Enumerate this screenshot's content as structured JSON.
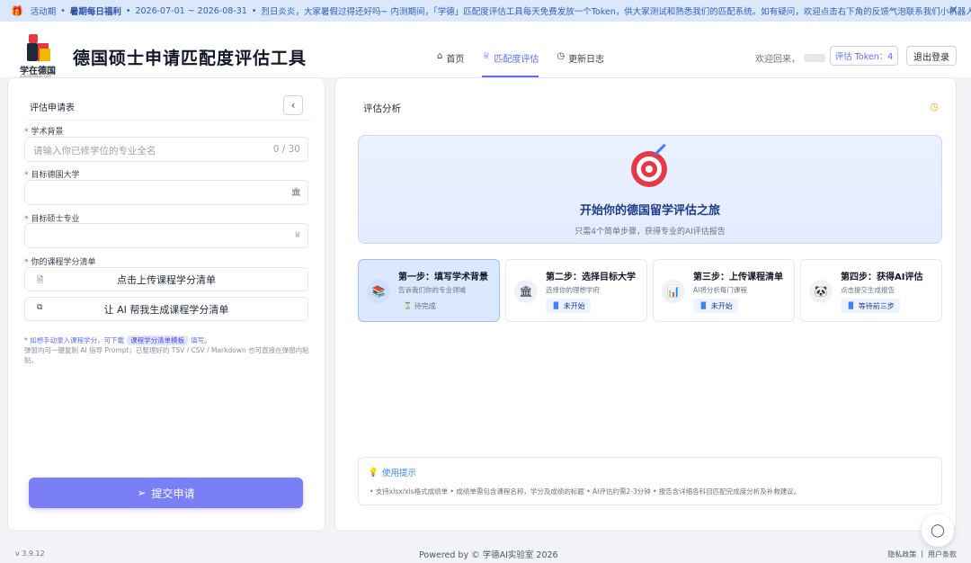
{
  "banner": {
    "gift_icon": "gift-icon",
    "label": "活动期",
    "campaign": "暑期每日福利",
    "dates": "2026-07-01 ~ 2026-08-31",
    "message": "烈日炎炎，大家暑假过得还好吗~ 内测期间，「学德」匹配度评估工具每天免费发放一个Token，供大家测试和熟悉我们的匹配系统。如有疑问，欢迎点击右下角的反馈气泡联系我们小机器人儿喔~",
    "close": "×"
  },
  "header": {
    "logo_text": "学在德国",
    "logo_sub": "xuezaideguo.com",
    "title": "德国硕士申请匹配度评估工具",
    "tabs": [
      {
        "label": "首页",
        "icon": "⌂"
      },
      {
        "label": "匹配度评估",
        "icon": "♕"
      },
      {
        "label": "更新日志",
        "icon": "◷"
      }
    ],
    "welcome": "欢迎回来，",
    "token_button": "评估 Token：4",
    "logout_button": "退出登录"
  },
  "form": {
    "title": "评估申请表",
    "collapse_icon": "‹",
    "academic_label": "学术背景",
    "academic_placeholder": "请输入你已修学位的专业全名",
    "academic_count": "0 / 30",
    "university_label": "目标德国大学",
    "major_label": "目标硕士专业",
    "course_label": "你的课程学分清单",
    "upload_button": "点击上传课程学分清单",
    "ai_button": "让 AI 帮我生成课程学分清单",
    "hint_prefix": "* 如想手动录入课程学分，可下载",
    "hint_template": "课程学分清单模板",
    "hint_suffix": "填写。",
    "hint_line2": "弹窗内可一键复制 AI 指导 Prompt；已整理好的 TSV / CSV / Markdown 也可直接在弹窗内粘贴。",
    "submit_button": "提交申请"
  },
  "analysis": {
    "title": "评估分析",
    "hero_title": "开始你的德国留学评估之旅",
    "hero_sub": "只需4个简单步骤，获得专业的AI评估报告",
    "steps": [
      {
        "title": "第一步：填写学术背景",
        "desc": "告诉我们你的专业领域",
        "status": "待完成",
        "icon": "📚"
      },
      {
        "title": "第二步：选择目标大学",
        "desc": "选择你的理想学府",
        "status": "未开始",
        "icon": "🏛"
      },
      {
        "title": "第三步：上传课程清单",
        "desc": "AI将分析每门课程",
        "status": "未开始",
        "icon": "📊"
      },
      {
        "title": "第四步：获得AI评估",
        "desc": "点击提交生成报告",
        "status": "等待前三步",
        "icon": "🐼"
      }
    ],
    "tips_title": "使用提示",
    "tips_body": "• 支持xlsx/xls格式成绩单  • 成绩单需包含课程名称，学分及成绩的标题  • AI评估约需2-3分钟  • 报告含详细各科目匹配完成度分析及补救建议。"
  },
  "footer": {
    "version": "v 3.9.12",
    "powered": "Powered by © 学德AI实验室 2026",
    "privacy": "隐私政策",
    "terms": "用户条款",
    "sep": "|"
  }
}
